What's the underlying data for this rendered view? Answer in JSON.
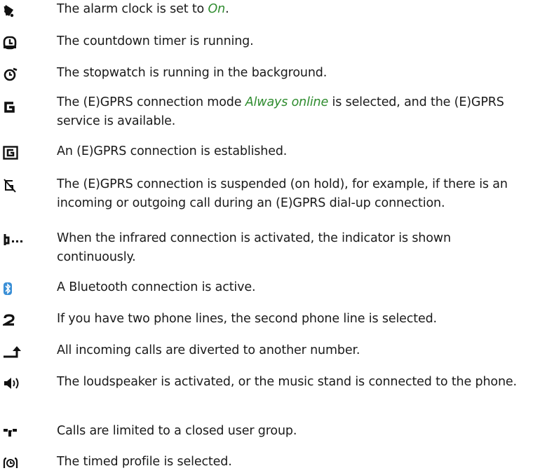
{
  "indicators": [
    {
      "icon": "alarm-clock-icon",
      "parts": [
        {
          "text": "The alarm clock is set to "
        },
        {
          "text": "On",
          "emphasis": true
        },
        {
          "text": "."
        }
      ]
    },
    {
      "icon": "countdown-timer-icon",
      "parts": [
        {
          "text": "The countdown timer is running."
        }
      ]
    },
    {
      "icon": "stopwatch-icon",
      "parts": [
        {
          "text": "The stopwatch is running in the background."
        }
      ]
    },
    {
      "icon": "egprs-available-icon",
      "parts": [
        {
          "text": "The (E)GPRS connection mode "
        },
        {
          "text": "Always online",
          "emphasis": true
        },
        {
          "text": " is selected, and the (E)GPRS service is available."
        }
      ]
    },
    {
      "icon": "egprs-connection-established-icon",
      "parts": [
        {
          "text": "An (E)GPRS connection is established."
        }
      ]
    },
    {
      "icon": "egprs-suspended-icon",
      "parts": [
        {
          "text": "The (E)GPRS connection is suspended (on hold), for example, if there is an incoming or outgoing call during an (E)GPRS dial-up connection."
        }
      ]
    },
    {
      "icon": "infrared-icon",
      "parts": [
        {
          "text": "When the infrared connection is activated, the indicator is shown continuously."
        }
      ]
    },
    {
      "icon": "bluetooth-icon",
      "parts": [
        {
          "text": "A Bluetooth connection is active."
        }
      ]
    },
    {
      "icon": "second-phone-line-icon",
      "parts": [
        {
          "text": "If you have two phone lines, the second phone line is selected."
        }
      ]
    },
    {
      "icon": "call-divert-icon",
      "parts": [
        {
          "text": "All incoming calls are diverted to another number."
        }
      ]
    },
    {
      "icon": "loudspeaker-icon",
      "parts": [
        {
          "text": "The loudspeaker is activated, or the music stand is connected to the phone."
        }
      ]
    },
    {
      "icon": "closed-user-group-icon",
      "parts": [
        {
          "text": "Calls are limited to a closed user group."
        }
      ]
    },
    {
      "icon": "timed-profile-icon",
      "parts": [
        {
          "text": "The timed profile is selected."
        }
      ]
    }
  ],
  "colors": {
    "emphasis": "#2e8b2e",
    "text": "#1a1a1a",
    "icon": "#111111",
    "bluetooth": "#3a8fd6"
  }
}
